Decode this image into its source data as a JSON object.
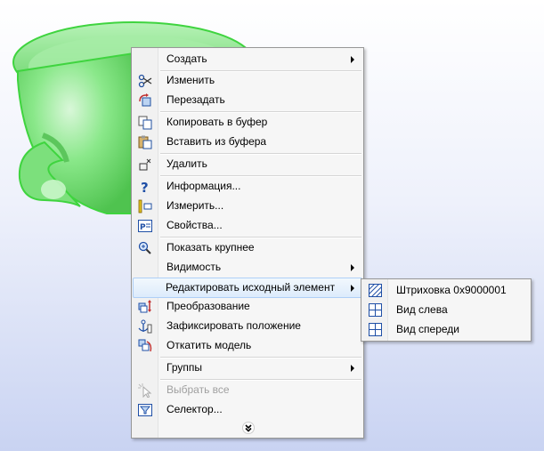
{
  "context_menu": {
    "items": [
      {
        "label": "Создать",
        "icon": "",
        "submenu": true
      },
      {
        "label": "Изменить",
        "icon": "scissors-icon"
      },
      {
        "label": "Перезадать",
        "icon": "redefine-icon"
      },
      {
        "label": "Копировать в буфер",
        "icon": "copy-icon"
      },
      {
        "label": "Вставить из буфера",
        "icon": "paste-icon"
      },
      {
        "label": "Удалить",
        "icon": "delete-icon"
      },
      {
        "label": "Информация...",
        "icon": "question-icon"
      },
      {
        "label": "Измерить...",
        "icon": "measure-icon"
      },
      {
        "label": "Свойства...",
        "icon": "properties-icon"
      },
      {
        "label": "Показать крупнее",
        "icon": "zoom-in-icon"
      },
      {
        "label": "Видимость",
        "icon": "",
        "submenu": true
      },
      {
        "label": "Редактировать исходный элемент",
        "icon": "",
        "submenu": true,
        "highlighted": true
      },
      {
        "label": "Преобразование",
        "icon": "transform-icon"
      },
      {
        "label": "Зафиксировать положение",
        "icon": "anchor-icon"
      },
      {
        "label": "Откатить модель",
        "icon": "rollback-icon"
      },
      {
        "label": "Группы",
        "icon": "",
        "submenu": true
      },
      {
        "label": "Выбрать все",
        "icon": "select-all-icon",
        "disabled": true
      },
      {
        "label": "Селектор...",
        "icon": "filter-icon"
      }
    ],
    "more_icon": "double-chevron-down-icon"
  },
  "submenu": {
    "items": [
      {
        "label": "Штриховка 0x9000001",
        "icon": "hatch-icon"
      },
      {
        "label": "Вид слева",
        "icon": "view-icon"
      },
      {
        "label": "Вид спереди",
        "icon": "view-icon"
      }
    ]
  },
  "colors": {
    "model_green": "#7fe07f",
    "menu_bg": "#f6f6f6",
    "highlight": "#dcebfc",
    "highlight_border": "#aecff7"
  }
}
